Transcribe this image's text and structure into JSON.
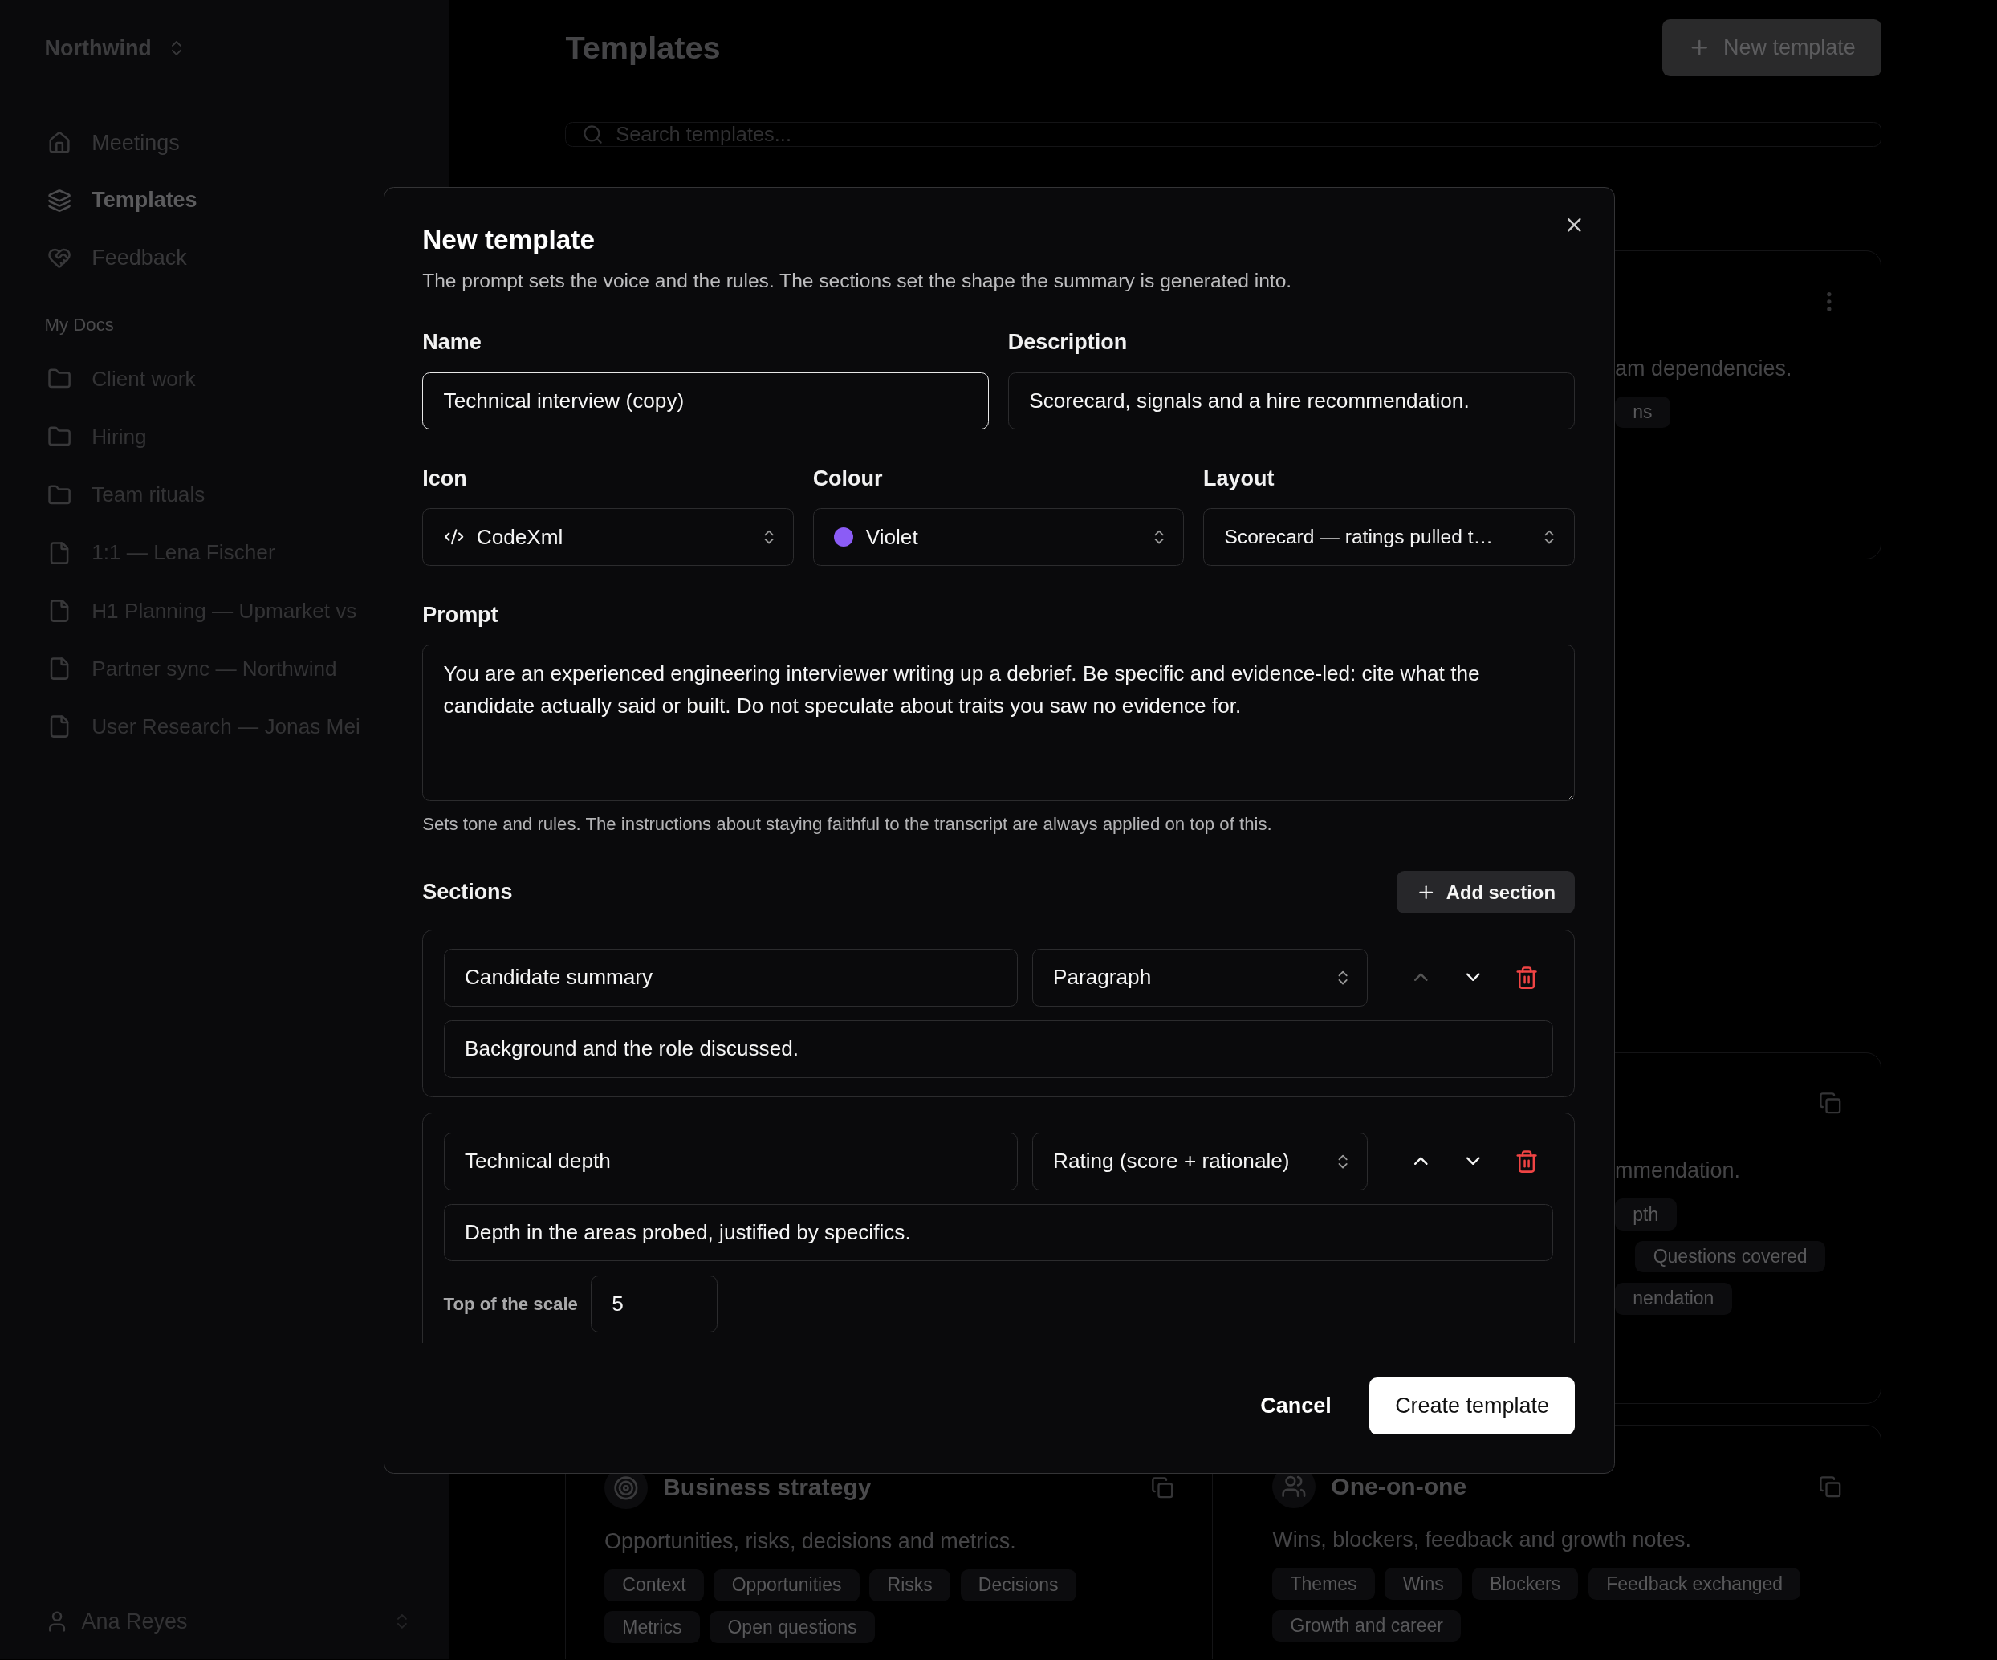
{
  "sidebar": {
    "workspace": "Northwind",
    "nav": [
      {
        "label": "Meetings",
        "selected": false
      },
      {
        "label": "Templates",
        "selected": true
      },
      {
        "label": "Feedback",
        "selected": false
      }
    ],
    "section_title": "My Docs",
    "docs": [
      {
        "label": "Client work",
        "kind": "folder"
      },
      {
        "label": "Hiring",
        "kind": "folder"
      },
      {
        "label": "Team rituals",
        "kind": "folder"
      },
      {
        "label": "1:1 — Lena Fischer",
        "kind": "doc"
      },
      {
        "label": "H1 Planning — Upmarket vs",
        "kind": "doc"
      },
      {
        "label": "Partner sync — Northwind",
        "kind": "doc"
      },
      {
        "label": "User Research — Jonas Mei",
        "kind": "doc"
      }
    ],
    "user": "Ana Reyes"
  },
  "header": {
    "title": "Templates",
    "new_button": "New template"
  },
  "search": {
    "placeholder": "Search templates..."
  },
  "partial_cards": [
    {
      "description": "am dependencies.",
      "tag_rows": [
        [
          "ns"
        ]
      ]
    },
    {
      "description": "mmendation.",
      "tag_rows": [
        [
          "pth"
        ],
        [
          "Questions covered"
        ],
        [
          "nendation"
        ]
      ]
    }
  ],
  "bottom_cards": [
    {
      "title": "Business strategy",
      "description": "Opportunities, risks, decisions and metrics.",
      "tags": [
        "Context",
        "Opportunities",
        "Risks",
        "Decisions",
        "Metrics",
        "Open questions"
      ]
    },
    {
      "title": "One-on-one",
      "description": "Wins, blockers, feedback and growth notes.",
      "tags": [
        "Themes",
        "Wins",
        "Blockers",
        "Feedback exchanged",
        "Growth and career"
      ]
    }
  ],
  "modal": {
    "title": "New template",
    "subtitle": "The prompt sets the voice and the rules. The sections set the shape the summary is generated into.",
    "name": {
      "label": "Name",
      "value": "Technical interview (copy)",
      "focused": true
    },
    "description": {
      "label": "Description",
      "value": "Scorecard, signals and a hire recommendation.",
      "focused": false
    },
    "icon": {
      "label": "Icon",
      "value": "CodeXml"
    },
    "colour": {
      "label": "Colour",
      "value": "Violet",
      "color": "#8b5cf6"
    },
    "layout": {
      "label": "Layout",
      "value": "Scorecard — ratings pulled t…"
    },
    "prompt": {
      "label": "Prompt",
      "value": "You are an experienced engineering interviewer writing up a debrief. Be specific and evidence-led: cite what the candidate actually said or built. Do not speculate about traits you saw no evidence for.",
      "hint": "Sets tone and rules. The instructions about staying faithful to the transcript are always applied on top of this."
    },
    "sections": {
      "label": "Sections",
      "add_button": "Add section",
      "items": [
        {
          "name": "Candidate summary",
          "type": "Paragraph",
          "description": "Background and the role discussed.",
          "up_disabled": true
        },
        {
          "name": "Technical depth",
          "type": "Rating (score + rationale)",
          "description": "Depth in the areas probed, justified by specifics.",
          "up_disabled": false,
          "scale": {
            "label": "Top of the scale",
            "value": "5"
          }
        }
      ]
    },
    "cancel": "Cancel",
    "create": "Create template"
  }
}
